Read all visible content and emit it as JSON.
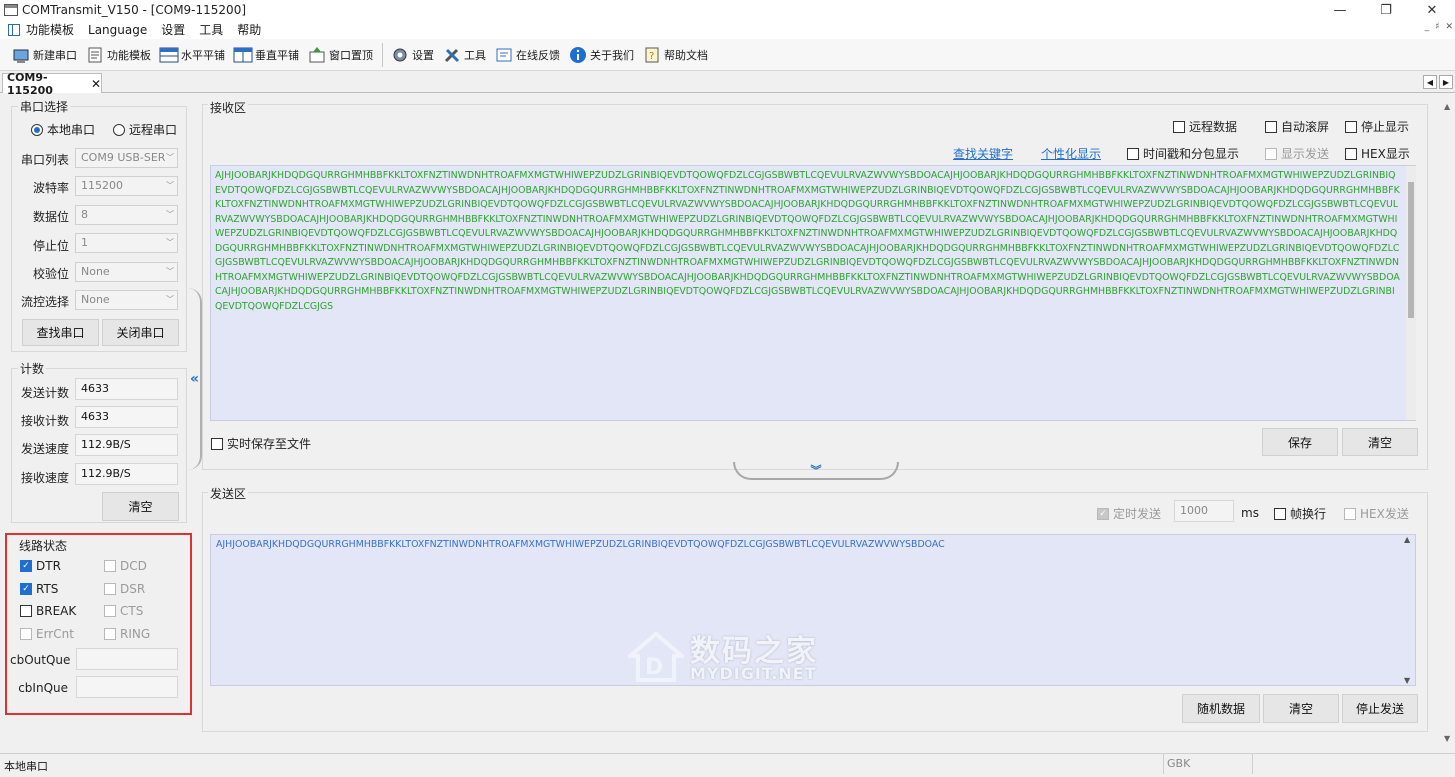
{
  "window": {
    "title": "COMTransmit_V150 - [COM9-115200]",
    "controls": [
      "—",
      "❐",
      "✕"
    ]
  },
  "menu": {
    "items": [
      "功能模板",
      "Language",
      "设置",
      "工具",
      "帮助"
    ],
    "mdi": [
      "_",
      "♯",
      "✕"
    ]
  },
  "toolbar": {
    "buttons": [
      {
        "label": "新建串口",
        "icon": "plug-icon"
      },
      {
        "label": "功能模板",
        "icon": "template-icon"
      },
      {
        "label": "水平平铺",
        "icon": "tile-horizontal-icon"
      },
      {
        "label": "垂直平铺",
        "icon": "tile-vertical-icon"
      },
      {
        "label": "窗口置顶",
        "icon": "pin-top-icon"
      },
      {
        "label": "设置",
        "icon": "gear-icon"
      },
      {
        "label": "工具",
        "icon": "tools-icon"
      },
      {
        "label": "在线反馈",
        "icon": "feedback-icon"
      },
      {
        "label": "关于我们",
        "icon": "info-icon"
      },
      {
        "label": "帮助文档",
        "icon": "help-doc-icon"
      }
    ]
  },
  "tab": {
    "label": "COM9-115200",
    "close": "✕",
    "nav_left": "◀",
    "nav_right": "▶"
  },
  "serial": {
    "group_title": "串口选择",
    "local_label": "本地串口",
    "remote_label": "远程串口",
    "local_selected": true,
    "port_label": "串口列表",
    "port_value": "COM9   USB-SER",
    "baud_label": "波特率",
    "baud_value": "115200",
    "databits_label": "数据位",
    "databits_value": "8",
    "stopbits_label": "停止位",
    "stopbits_value": "1",
    "parity_label": "校验位",
    "parity_value": "None",
    "flow_label": "流控选择",
    "flow_value": "None",
    "find_button": "查找串口",
    "close_button": "关闭串口"
  },
  "counter": {
    "group_title": "计数",
    "send_count_label": "发送计数",
    "send_count_value": "4633",
    "recv_count_label": "接收计数",
    "recv_count_value": "4633",
    "send_speed_label": "发送速度",
    "send_speed_value": "112.9B/S",
    "recv_speed_label": "接收速度",
    "recv_speed_value": "112.9B/S",
    "clear_button": "清空"
  },
  "line_status": {
    "group_title": "线路状态",
    "dtr": {
      "label": "DTR",
      "checked": true
    },
    "dcd": {
      "label": "DCD",
      "checked": false
    },
    "rts": {
      "label": "RTS",
      "checked": true
    },
    "dsr": {
      "label": "DSR",
      "checked": false
    },
    "break": {
      "label": "BREAK",
      "checked": false
    },
    "cts": {
      "label": "CTS",
      "checked": false
    },
    "errcnt": {
      "label": "ErrCnt",
      "checked": false
    },
    "ring": {
      "label": "RING",
      "checked": false
    },
    "cbout_label": "cbOutQue",
    "cbout_value": "",
    "cbin_label": "cbInQue",
    "cbin_value": ""
  },
  "receive": {
    "group_title": "接收区",
    "remote_data": "远程数据",
    "auto_scroll": "自动滚屏",
    "stop_display": "停止显示",
    "find_keyword": "查找关键字",
    "custom_display": "个性化显示",
    "timestamp": "时间戳和分包显示",
    "show_send": "显示发送",
    "hex_display": "HEX显示",
    "save_realtime": "实时保存至文件",
    "save_button": "保存",
    "clear_button": "清空",
    "text": "AJHJOOBARJKHDQDGQURRGHMHBBFKKLTOXFNZTINWDNHTROAFMXMGTWHIWEPZUDZLGRINBIQEVDTQOWQFDZLCGJGSBWBTLCQEVULRVAZWVWYSBDOACAJHJOOBARJKHDQDGQURRGHMHBBFKKLTOXFNZTINWDNHTROAFMXMGTWHIWEPZUDZLGRINBIQEVDTQOWQFDZLCGJGSBWBTLCQEVULRVAZWVWYSBDOACAJHJOOBARJKHDQDGQURRGHMHBBFKKLTOXFNZTINWDNHTROAFMXMGTWHIWEPZUDZLGRINBIQEVDTQOWQFDZLCGJGSBWBTLCQEVULRVAZWVWYSBDOACAJHJOOBARJKHDQDGQURRGHMHBBFKKLTOXFNZTINWDNHTROAFMXMGTWHIWEPZUDZLGRINBIQEVDTQOWQFDZLCGJGSBWBTLCQEVULRVAZWVWYSBDOACAJHJOOBARJKHDQDGQURRGHMHBBFKKLTOXFNZTINWDNHTROAFMXMGTWHIWEPZUDZLGRINBIQEVDTQOWQFDZLCGJGSBWBTLCQEVULRVAZWVWYSBDOACAJHJOOBARJKHDQDGQURRGHMHBBFKKLTOXFNZTINWDNHTROAFMXMGTWHIWEPZUDZLGRINBIQEVDTQOWQFDZLCGJGSBWBTLCQEVULRVAZWVWYSBDOACAJHJOOBARJKHDQDGQURRGHMHBBFKKLTOXFNZTINWDNHTROAFMXMGTWHIWEPZUDZLGRINBIQEVDTQOWQFDZLCGJGSBWBTLCQEVULRVAZWVWYSBDOACAJHJOOBARJKHDQDGQURRGHMHBBFKKLTOXFNZTINWDNHTROAFMXMGTWHIWEPZUDZLGRINBIQEVDTQOWQFDZLCGJGSBWBTLCQEVULRVAZWVWYSBDOACAJHJOOBARJKHDQDGQURRGHMHBBFKKLTOXFNZTINWDNHTROAFMXMGTWHIWEPZUDZLGRINBIQEVDTQOWQFDZLCGJGSBWBTLCQEVULRVAZWVWYSBDOACAJHJOOBARJKHDQDGQURRGHMHBBFKKLTOXFNZTINWDNHTROAFMXMGTWHIWEPZUDZLGRINBIQEVDTQOWQFDZLCGJGSBWBTLCQEVULRVAZWVWYSBDOACAJHJOOBARJKHDQDGQURRGHMHBBFKKLTOXFNZTINWDNHTROAFMXMGTWHIWEPZUDZLGRINBIQEVDTQOWQFDZLCGJGSBWBTLCQEVULRVAZWVWYSBDOACAJHJOOBARJKHDQDGQURRGHMHBBFKKLTOXFNZTINWDNHTROAFMXMGTWHIWEPZUDZLGRINBIQEVDTQOWQFDZLCGJGSBWBTLCQEVULRVAZWVWYSBDOACAJHJOOBARJKHDQDGQURRGHMHBBFKKLTOXFNZTINWDNHTROAFMXMGTWHIWEPZUDZLGRINBIQEVDTQOWQFDZLCGJGSBWBTLCQEVULRVAZWVWYSBDOACAJHJOOBARJKHDQDGQURRGHMHBBFKKLTOXFNZTINWDNHTROAFMXMGTWHIWEPZUDZLGRINBIQEVDTQOWQFDZLCGJGSBWBTLCQEVULRVAZWVWYSBDOACAJHJOOBARJKHDQDGQURRGHMHBBFKKLTOXFNZTINWDNHTROAFMXMGTWHIWEPZUDZLGRINBIQEVDTQOWQFDZLCGJGS"
  },
  "send": {
    "group_title": "发送区",
    "timed_send": "定时发送",
    "interval": "1000",
    "unit": "ms",
    "frame_newline": "帧换行",
    "hex_send": "HEX发送",
    "text": "AJHJOOBARJKHDQDGQURRGHMHBBFKKLTOXFNZTINWDNHTROAFMXMGTWHIWEPZUDZLGRINBIQEVDTQOWQFDZLCGJGSBWBTLCQEVULRVAZWVWYSBDOAC",
    "random_button": "随机数据",
    "clear_button": "清空",
    "stop_button": "停止发送"
  },
  "status": {
    "left": "本地串口",
    "encoding": "GBK"
  },
  "watermark": {
    "cn": "数码之家",
    "en": "MYDIGIT.NET"
  },
  "colors": {
    "accent": "#1f6fd1",
    "recv_text": "#2ea32e",
    "send_text": "#3870c8",
    "textarea_bg": "#e2e6f7",
    "highlight_box": "#e03030"
  }
}
